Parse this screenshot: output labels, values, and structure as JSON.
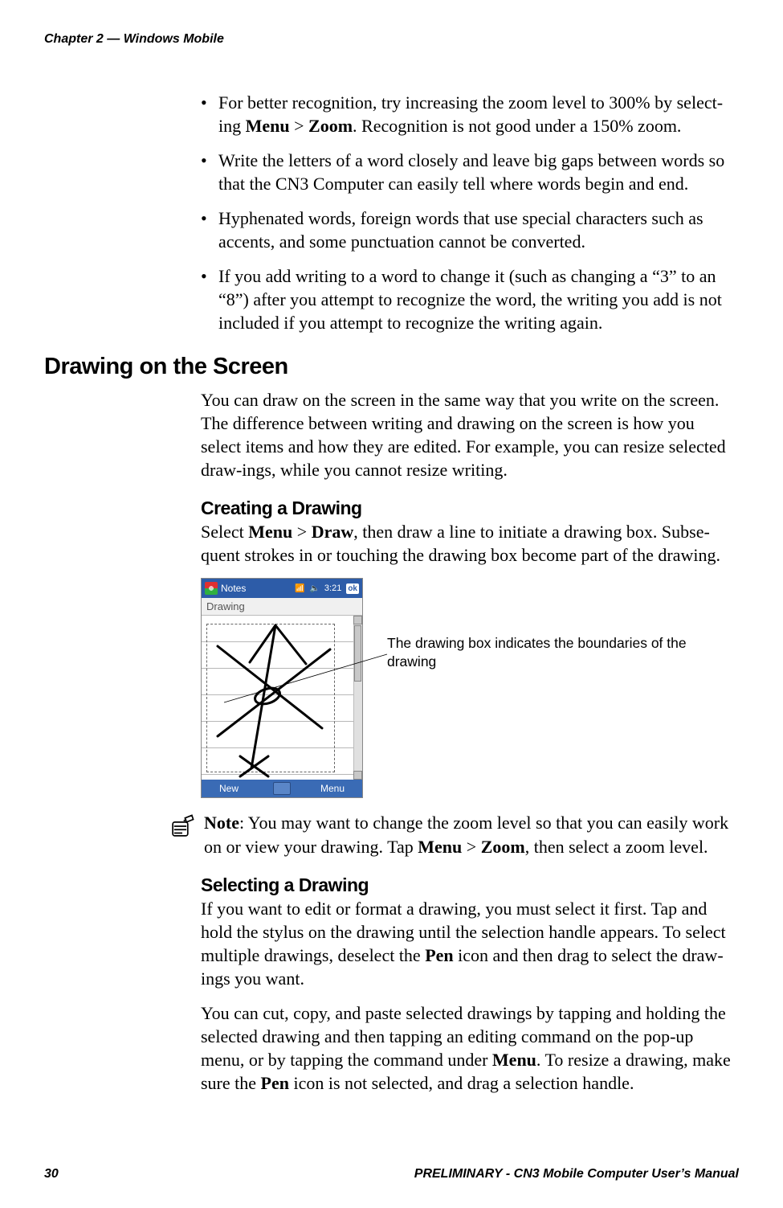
{
  "header": {
    "chapter": "Chapter 2 — Windows Mobile"
  },
  "bullets": [
    {
      "pre": "For better recognition, try increasing the zoom level to 300% by select-ing ",
      "b1": "Menu",
      "mid1": " > ",
      "b2": "Zoom",
      "post": ". Recognition is not good under a 150% zoom."
    },
    {
      "text": "Write the letters of a word closely and leave big gaps between words so that the CN3 Computer can easily tell where words begin and end."
    },
    {
      "text": "Hyphenated words, foreign words that use special characters such as accents, and some punctuation cannot be converted."
    },
    {
      "text": "If you add writing to a word to change it (such as changing a “3” to an “8”) after you attempt to recognize the word, the writing you add is not included if you attempt to recognize the writing again."
    }
  ],
  "section": {
    "title": "Drawing on the Screen"
  },
  "section_body": "You can draw on the screen in the same way that you write on the screen. The difference between writing and drawing on the screen is how you select items and how they are edited. For example, you can resize selected draw-ings, while you cannot resize writing.",
  "creating": {
    "title": "Creating a Drawing",
    "pre": "Select ",
    "b1": "Menu",
    "mid": " > ",
    "b2": "Draw",
    "post": ", then draw a line to initiate a drawing box. Subse-quent strokes in or touching the drawing box become part of the drawing."
  },
  "phone": {
    "app": "Notes",
    "time": "3:21",
    "ok": "ok",
    "title": "Drawing",
    "left_soft": "New",
    "right_soft": "Menu"
  },
  "callout": "The drawing box indicates the boundaries of the drawing",
  "note": {
    "label": "Note",
    "pre": ": You may want to change the zoom level so that you can easily work on or view your drawing. Tap ",
    "b1": "Menu",
    "mid": " > ",
    "b2": "Zoom",
    "post": ", then select a zoom level."
  },
  "selecting": {
    "title": "Selecting a Drawing",
    "p1_pre": "If you want to edit or format a drawing, you must select it first. Tap and hold the stylus on the drawing until the selection handle appears. To select multiple drawings, deselect the ",
    "p1_b1": "Pen",
    "p1_post": " icon and then drag to select the draw-ings you want.",
    "p2_pre": "You can cut, copy, and paste selected drawings by tapping and holding the selected drawing and then tapping an editing command on the pop-up menu, or by tapping the command under ",
    "p2_b1": "Menu",
    "p2_mid": ". To resize a drawing, make sure the ",
    "p2_b2": "Pen",
    "p2_post": " icon is not selected, and drag a selection handle."
  },
  "footer": {
    "page": "30",
    "doc": "PRELIMINARY - CN3 Mobile Computer User’s Manual"
  }
}
